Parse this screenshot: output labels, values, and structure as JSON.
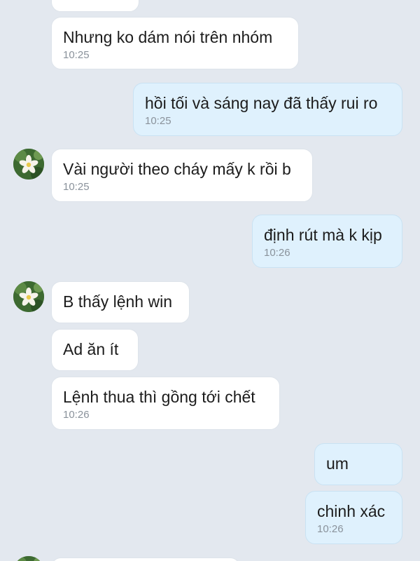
{
  "chat": {
    "messages": [
      {
        "text": "",
        "time": ""
      },
      {
        "text": "Nhưng ko dám nói trên nhóm",
        "time": "10:25"
      },
      {
        "text": "hồi tối và sáng nay đã thấy rui ro",
        "time": "10:25"
      },
      {
        "text": "Vài người theo cháy mấy k rồi b",
        "time": "10:25"
      },
      {
        "text": "định rút mà k kịp",
        "time": "10:26"
      },
      {
        "text": "B thấy lệnh win",
        "time": ""
      },
      {
        "text": "Ad ăn ít",
        "time": ""
      },
      {
        "text": "Lệnh thua thì gồng tới chết",
        "time": "10:26"
      },
      {
        "text": "um",
        "time": ""
      },
      {
        "text": "chinh xác",
        "time": "10:26"
      },
      {
        "text": "",
        "time": ""
      }
    ],
    "avatar_icon": "lotus-flower-avatar-icon",
    "colors": {
      "background": "#e3e8ef",
      "incoming_bubble": "#ffffff",
      "outgoing_bubble": "#dff1fd",
      "timestamp": "#8a929b"
    }
  }
}
